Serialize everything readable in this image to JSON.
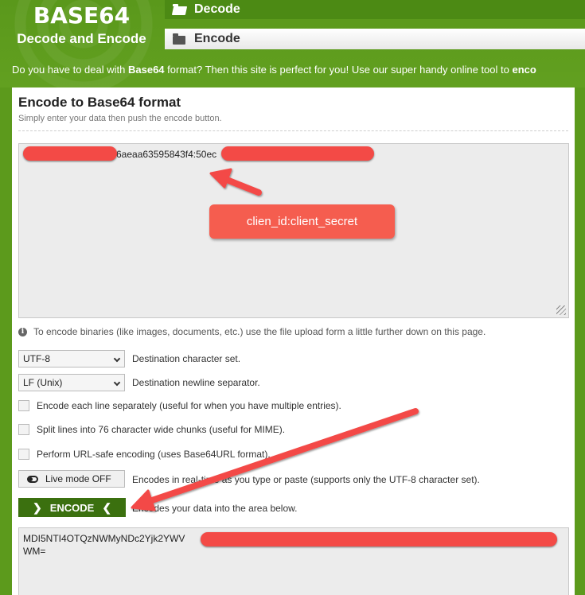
{
  "site": {
    "title": "BASE64",
    "subtitle": "Decode and Encode"
  },
  "nav": {
    "decode_label": "Decode",
    "encode_label": "Encode"
  },
  "intro": {
    "before": "Do you have to deal with ",
    "bold1": "Base64",
    "after": " format? Then this site is perfect for you! Use our super handy online tool to ",
    "bold2": "enco"
  },
  "panel": {
    "heading": "Encode to Base64 format",
    "hint": "Simply enter your data then push the encode button."
  },
  "input": {
    "visible_text": "6aeaa63595843f4:50ec"
  },
  "callout": {
    "text": "clien_id:client_secret"
  },
  "info": {
    "text": "To encode binaries (like images, documents, etc.) use the file upload form a little further down on this page."
  },
  "options": {
    "charset_value": "UTF-8",
    "charset_label": "Destination character set.",
    "newline_value": "LF (Unix)",
    "newline_label": "Destination newline separator.",
    "each_line_label": "Encode each line separately (useful for when you have multiple entries).",
    "split_label": "Split lines into 76 character wide chunks (useful for MIME).",
    "urlsafe_label": "Perform URL-safe encoding (uses Base64URL format).",
    "live_button": "Live mode OFF",
    "live_label": "Encodes in real-time as you type or paste (supports only the UTF-8 character set).",
    "encode_button": "ENCODE",
    "encode_label": "Encodes your data into the area below."
  },
  "output": {
    "line1": "MDI5NTI4OTQzNWMyNDc2Yjk2YWV",
    "line2": "WM="
  },
  "colors": {
    "brand_green": "#5c9a1c",
    "encode_button": "#3b700f",
    "annotation": "#f34a46"
  }
}
